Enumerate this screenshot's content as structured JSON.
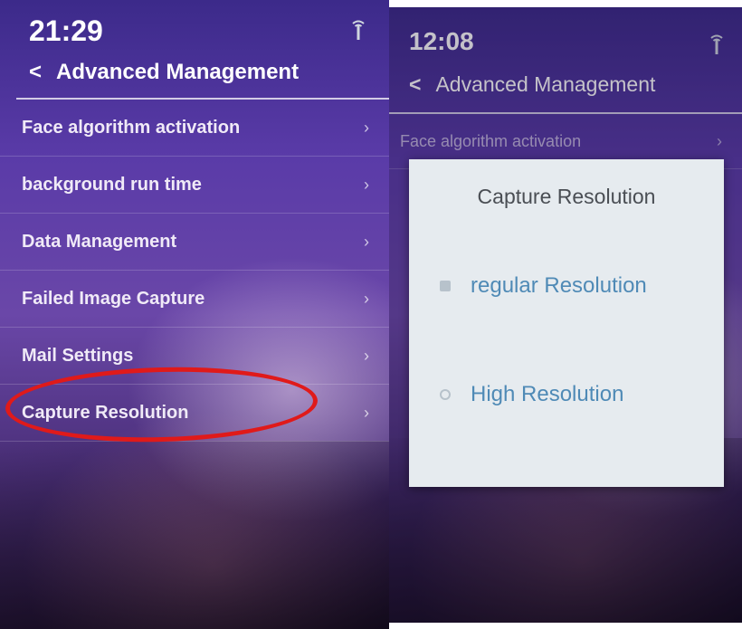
{
  "left_screen": {
    "time": "21:29",
    "title": "Advanced Management",
    "back_glyph": "<",
    "signal_icon": "signal-icon",
    "items": [
      {
        "label": "Face algorithm activation"
      },
      {
        "label": "background run time"
      },
      {
        "label": "Data Management"
      },
      {
        "label": "Failed Image Capture"
      },
      {
        "label": "Mail Settings"
      },
      {
        "label": "Capture Resolution"
      }
    ],
    "chevron": "›",
    "highlight_color": "#e01a1a"
  },
  "right_screen": {
    "time": "12:08",
    "title": "Advanced Management",
    "back_glyph": "<",
    "signal_icon": "signal-icon",
    "items": [
      {
        "label": "Face algorithm activation"
      }
    ],
    "chevron": "›",
    "dialog": {
      "title": "Capture Resolution",
      "options": [
        {
          "label": "regular Resolution"
        },
        {
          "label": "High Resolution"
        }
      ]
    }
  },
  "colors": {
    "background_top": "#3c2a8a",
    "dialog_bg": "#e6ebef",
    "option_text": "#4f8ab6"
  }
}
